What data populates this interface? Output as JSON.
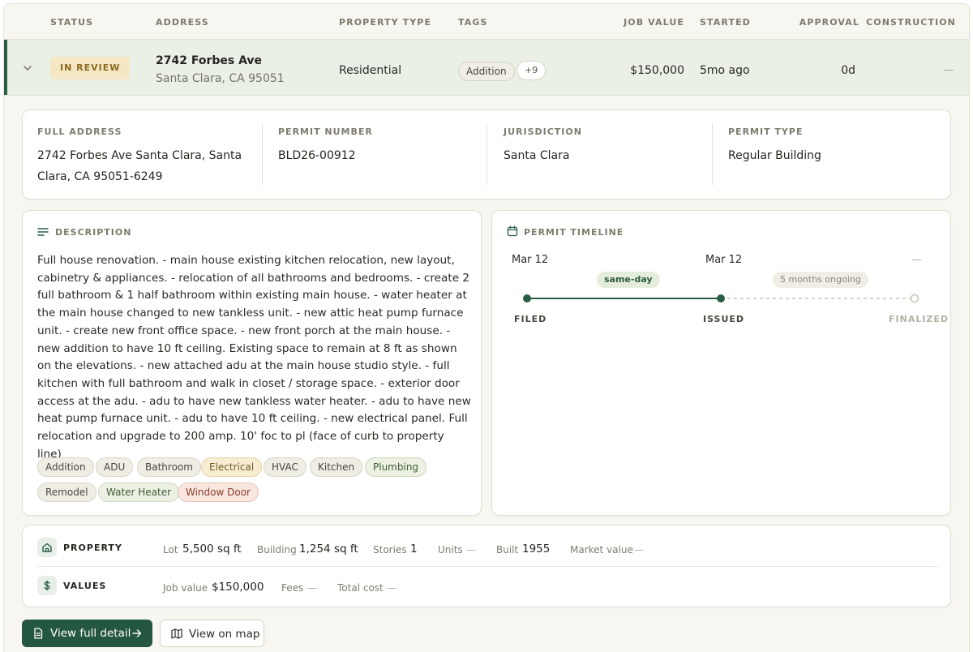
{
  "table": {
    "headers": {
      "status": "STATUS",
      "address": "ADDRESS",
      "property_type": "PROPERTY TYPE",
      "tags": "TAGS",
      "job_value": "JOB VALUE",
      "started": "STARTED",
      "approval": "APPROVAL",
      "construction": "CONSTRUCTION"
    },
    "row": {
      "status": "IN REVIEW",
      "address_line1": "2742 Forbes Ave",
      "address_line2": "Santa Clara, CA 95051",
      "property_type": "Residential",
      "tag": "Addition",
      "more_tags": "+9",
      "job_value": "$150,000",
      "started": "5mo ago",
      "approval": "0d",
      "construction": "—"
    }
  },
  "details": {
    "full_address_label": "FULL ADDRESS",
    "full_address_line1": "2742 Forbes Ave Santa Clara, Santa",
    "full_address_line2": "Clara, CA 95051-6249",
    "permit_number_label": "PERMIT NUMBER",
    "permit_number": "BLD26-00912",
    "jurisdiction_label": "JURISDICTION",
    "jurisdiction": "Santa Clara",
    "permit_type_label": "PERMIT TYPE",
    "permit_type": "Regular Building"
  },
  "description": {
    "label": "DESCRIPTION",
    "text": "Full house renovation. - main house existing kitchen relocation, new layout, cabinetry & appliances. - relocation of all bathrooms and bedrooms. - create 2 full bathroom & 1 half bathroom within existing main house. - water heater at the main house changed to new tankless unit. - new attic heat pump furnace unit. - create new front office space. - new front porch at the main house. - new addition to have 10 ft ceiling. Existing space to remain at 8 ft as shown on the elevations. - new attached adu at the main house studio style. - full kitchen with full bathroom and walk in closet / storage space. - exterior door access at the adu. - adu to have new tankless water heater. - adu to have new heat pump furnace unit. - adu to have 10 ft ceiling. - new electrical panel. Full relocation and upgrade to 200 amp. 10' foc to pl (face of curb to property line)",
    "chips": [
      "Addition",
      "ADU",
      "Bathroom",
      "Electrical",
      "HVAC",
      "Kitchen",
      "Plumbing",
      "Remodel",
      "Water Heater",
      "Window Door"
    ]
  },
  "timeline": {
    "label": "PERMIT TIMELINE",
    "filed_date": "Mar 12",
    "issued_date": "Mar 12",
    "finalized_date": "—",
    "first_interval": "same-day",
    "second_interval": "5 months ongoing",
    "filed_label": "FILED",
    "issued_label": "ISSUED",
    "finalized_label": "FINALIZED"
  },
  "property": {
    "label": "PROPERTY",
    "lot_key": "Lot",
    "lot_value": "5,500 sq ft",
    "building_key": "Building",
    "building_value": "1,254 sq ft",
    "stories_key": "Stories",
    "stories_value": "1",
    "units_key": "Units",
    "units_value": "—",
    "built_key": "Built",
    "built_value": "1955",
    "market_key": "Market value",
    "market_value": "—"
  },
  "values": {
    "label": "VALUES",
    "job_key": "Job value",
    "job_value": "$150,000",
    "fees_key": "Fees",
    "fees_value": "—",
    "total_key": "Total cost",
    "total_value": "—"
  },
  "actions": {
    "primary": "View full detail",
    "secondary": "View on map"
  },
  "colors": {
    "accent": "#2a5e46",
    "status_bg": "#f5e7c4",
    "status_text": "#8a6a1f"
  }
}
